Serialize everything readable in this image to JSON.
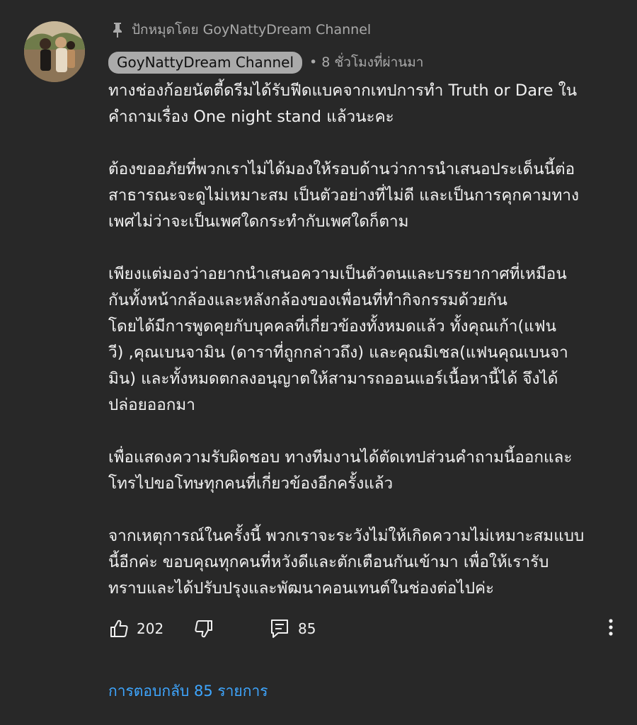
{
  "pinned_label": "ปักหมุดโดย GoyNattyDream Channel",
  "author": "GoyNattyDream Channel",
  "timestamp": "• 8 ชั่วโมงที่ผ่านมา",
  "paragraphs": [
    "ทางช่องก้อยนัตตี้ดรีมได้รับฟีดแบคจากเทปการทำ Truth or Dare ใน\nคำถามเรื่อง One night stand แล้วนะคะ",
    "ต้องขออภัยที่พวกเราไม่ได้มองให้รอบด้านว่าการนำเสนอประเด็นนี้ต่อ\nสาธารณะจะดูไม่เหมาะสม เป็นตัวอย่างที่ไม่ดี และเป็นการคุกคามทาง\nเพศไม่ว่าจะเป็นเพศใดกระทำกับเพศใดก็ตาม",
    "เพียงแต่มองว่าอยากนำเสนอความเป็นตัวตนและบรรยากาศที่เหมือน\nกันทั้งหน้ากล้องและหลังกล้องของเพื่อนที่ทำกิจกรรมด้วยกัน\nโดยได้มีการพูดคุยกับบุคคลที่เกี่ยวข้องทั้งหมดแล้ว ทั้งคุณเก้า(แฟน\nวี) ,คุณเบนจามิน (ดาราที่ถูกกล่าวถึง) และคุณมิเชล(แฟนคุณเบนจา\nมิน) และทั้งหมดตกลงอนุญาตให้สามารถออนแอร์เนื้อหานี้ได้ จึงได้\nปล่อยออกมา",
    "เพื่อแสดงความรับผิดชอบ ทางทีมงานได้ตัดเทปส่วนคำถามนี้ออกและ\nโทรไปขอโทษทุกคนที่เกี่ยวข้องอีกครั้งแล้ว",
    "จากเหตุการณ์ในครั้งนี้ พวกเราจะระวังไม่ให้เกิดความไม่เหมาะสมแบบ\nนี้อีกค่ะ ขอบคุณทุกคนที่หวังดีและตักเตือนกันเข้ามา เพื่อให้เรารับ\nทราบและได้ปรับปรุงและพัฒนาคอนเทนต์ในช่องต่อไปค่ะ"
  ],
  "likes": "202",
  "reply_count": "85",
  "replies_link": "การตอบกลับ 85 รายการ",
  "icons": {
    "pin": "pin-icon",
    "like": "thumbs-up-icon",
    "dislike": "thumbs-down-icon",
    "reply": "comment-icon",
    "more": "more-vertical-icon"
  },
  "colors": {
    "background": "#282828",
    "text": "#f1f1f1",
    "secondary": "#aaaaaa",
    "link": "#3ea6ff"
  }
}
